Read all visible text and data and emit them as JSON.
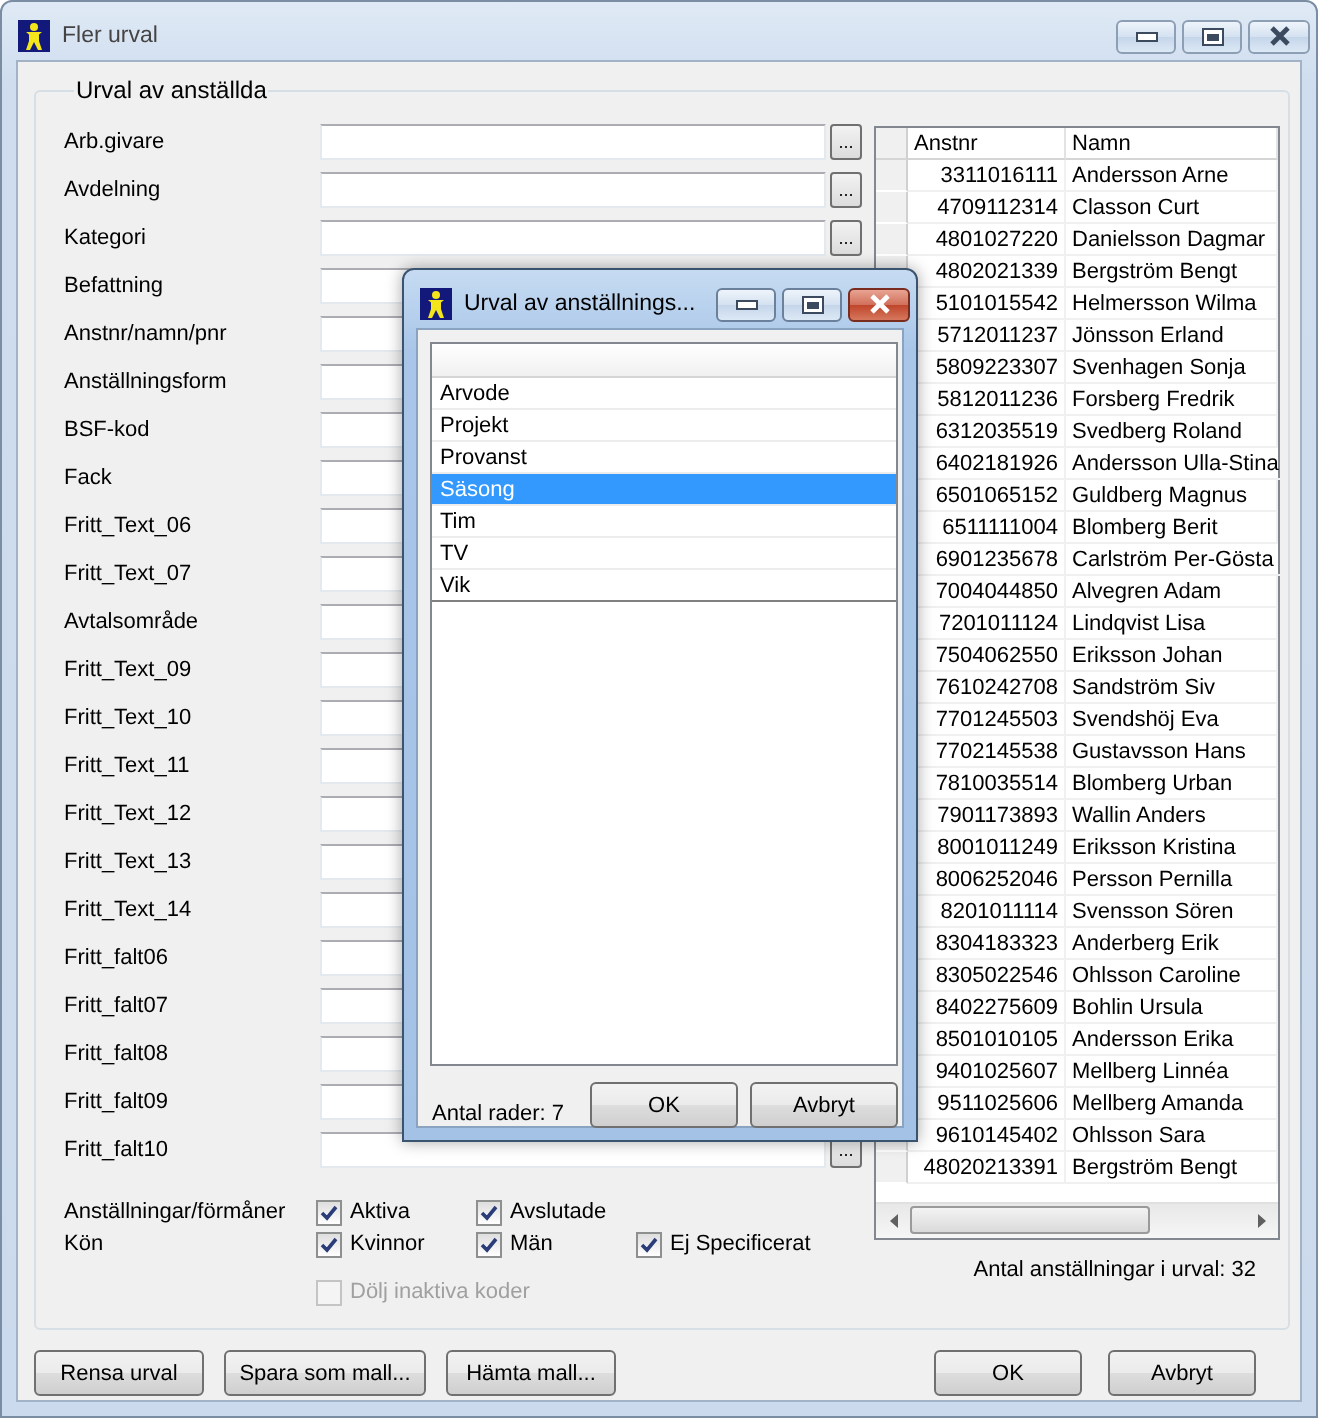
{
  "window": {
    "title": "Fler urval",
    "active": false
  },
  "group": {
    "title": "Urval av anställda"
  },
  "fields": [
    {
      "label": "Arb.givare",
      "browse_button": "..."
    },
    {
      "label": "Avdelning",
      "browse_button": "..."
    },
    {
      "label": "Kategori",
      "browse_button": "..."
    },
    {
      "label": "Befattning"
    },
    {
      "label": "Anstnr/namn/pnr"
    },
    {
      "label": "Anställningsform"
    },
    {
      "label": "BSF-kod"
    },
    {
      "label": "Fack"
    },
    {
      "label": "Fritt_Text_06"
    },
    {
      "label": "Fritt_Text_07"
    },
    {
      "label": "Avtalsområde"
    },
    {
      "label": "Fritt_Text_09"
    },
    {
      "label": "Fritt_Text_10"
    },
    {
      "label": "Fritt_Text_11"
    },
    {
      "label": "Fritt_Text_12"
    },
    {
      "label": "Fritt_Text_13"
    },
    {
      "label": "Fritt_Text_14"
    },
    {
      "label": "Fritt_falt06"
    },
    {
      "label": "Fritt_falt07"
    },
    {
      "label": "Fritt_falt08"
    },
    {
      "label": "Fritt_falt09"
    },
    {
      "label": "Fritt_falt10",
      "browse_button": "..."
    }
  ],
  "filters": [
    {
      "label": "Anställningar/förmåner",
      "options": [
        {
          "label": "Aktiva",
          "checked": true
        },
        {
          "label": "Avslutade",
          "checked": true
        }
      ]
    },
    {
      "label": "Kön",
      "options": [
        {
          "label": "Kvinnor",
          "checked": true
        },
        {
          "label": "Män",
          "checked": true
        },
        {
          "label": "Ej Specificerat",
          "checked": true
        }
      ]
    }
  ],
  "hide_inactive": {
    "label": "Dölj inaktiva koder",
    "checked": false,
    "disabled": true
  },
  "grid": {
    "columns": [
      "Anstnr",
      "Namn"
    ],
    "rows": [
      [
        "3311016111",
        "Andersson Arne"
      ],
      [
        "4709112314",
        "Classon Curt"
      ],
      [
        "4801027220",
        "Danielsson Dagmar"
      ],
      [
        "4802021339",
        "Bergström Bengt"
      ],
      [
        "5101015542",
        "Helmersson Wilma"
      ],
      [
        "5712011237",
        "Jönsson Erland"
      ],
      [
        "5809223307",
        "Svenhagen Sonja"
      ],
      [
        "5812011236",
        "Forsberg Fredrik"
      ],
      [
        "6312035519",
        "Svedberg Roland"
      ],
      [
        "6402181926",
        "Andersson Ulla-Stina"
      ],
      [
        "6501065152",
        "Guldberg Magnus"
      ],
      [
        "6511111004",
        "Blomberg Berit"
      ],
      [
        "6901235678",
        "Carlström Per-Gösta"
      ],
      [
        "7004044850",
        "Alvegren Adam"
      ],
      [
        "7201011124",
        "Lindqvist Lisa"
      ],
      [
        "7504062550",
        "Eriksson Johan"
      ],
      [
        "7610242708",
        "Sandström Siv"
      ],
      [
        "7701245503",
        "Svendshöj Eva"
      ],
      [
        "7702145538",
        "Gustavsson Hans"
      ],
      [
        "7810035514",
        "Blomberg Urban"
      ],
      [
        "7901173893",
        "Wallin Anders"
      ],
      [
        "8001011249",
        "Eriksson Kristina"
      ],
      [
        "8006252046",
        "Persson Pernilla"
      ],
      [
        "8201011114",
        "Svensson Sören"
      ],
      [
        "8304183323",
        "Anderberg Erik"
      ],
      [
        "8305022546",
        "Ohlsson Caroline"
      ],
      [
        "8402275609",
        "Bohlin Ursula"
      ],
      [
        "8501010105",
        "Andersson Erika"
      ],
      [
        "9401025607",
        "Mellberg Linnéa"
      ],
      [
        "9511025606",
        "Mellberg Amanda"
      ],
      [
        "9610145402",
        "Ohlsson Sara"
      ],
      [
        "48020213391",
        "Bergström Bengt"
      ]
    ]
  },
  "selection_count": "Antal anställningar i urval: 32",
  "buttons_left": [
    "Rensa urval",
    "Spara som mall...",
    "Hämta mall..."
  ],
  "buttons_right": [
    "OK",
    "Avbryt"
  ],
  "dialog": {
    "title": "Urval av anställnings...",
    "active": true,
    "items": [
      {
        "label": "Arvode",
        "selected": false
      },
      {
        "label": "Projekt",
        "selected": false
      },
      {
        "label": "Provanst",
        "selected": false
      },
      {
        "label": "Säsong",
        "selected": true
      },
      {
        "label": "Tim",
        "selected": false
      },
      {
        "label": "TV",
        "selected": false
      },
      {
        "label": "Vik",
        "selected": false
      }
    ],
    "row_count": "Antal rader: 7",
    "buttons": [
      "OK",
      "Avbryt"
    ]
  }
}
